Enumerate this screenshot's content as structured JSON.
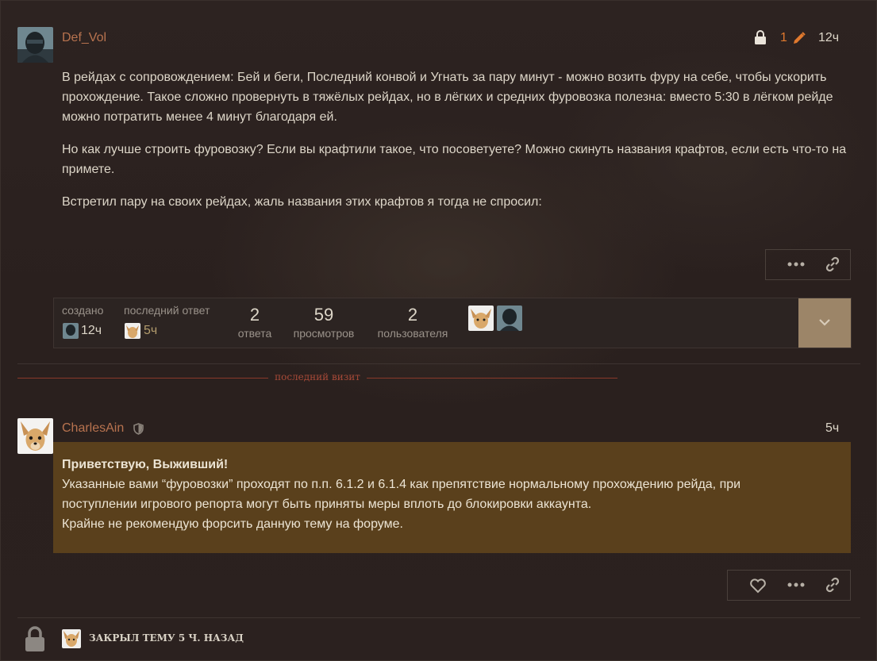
{
  "post1": {
    "username": "Def_Vol",
    "edit_count": "1",
    "time": "12ч",
    "paragraphs": [
      "В рейдах с сопровождением: Бей и беги, Последний конвой и Угнать за пару минут - можно возить фуру на себе, чтобы ускорить прохождение. Такое сложно провернуть в тяжёлых рейдах, но в лёгких и средних фуровозка полезна: вместо 5:30 в лёгком рейде можно потратить менее 4 минут благодаря ей.",
      "Но как лучше строить фуровозку? Если вы крафтили такое, что посоветуете? Можно скинуть названия крафтов, если есть что-то на примете.",
      "Встретил пару на своих рейдах, жаль названия этих крафтов я тогда не спросил:"
    ]
  },
  "topic_map": {
    "created_label": "создано",
    "created_time": "12ч",
    "last_reply_label": "последний ответ",
    "last_reply_time": "5ч",
    "replies_count": "2",
    "replies_label": "ответа",
    "views_count": "59",
    "views_label": "просмотров",
    "users_count": "2",
    "users_label": "пользователя"
  },
  "last_visit_label": "последний визит",
  "post2": {
    "username": "CharlesAin",
    "time": "5ч",
    "greeting": "Приветствую, Выживший!",
    "lines": [
      "Указанные вами “фуровозки” проходят по п.п. 6.1.2 и 6.1.4 как препятствие нормальному прохождению рейда, при",
      "поступлении игрового репорта могут быть приняты меры вплоть до блокировки аккаунта.",
      "Крайне не рекомендую форсить данную тему на форуме."
    ]
  },
  "closed_notice": "ЗАКРЫЛ ТЕМУ 5 Ч. НАЗАД",
  "colors": {
    "accent": "#e0792e",
    "username": "#b8734f",
    "mod_box": "#5a401c",
    "divider": "#8a3a2a"
  },
  "icons": {
    "lock": "lock-icon",
    "pencil": "pencil-icon",
    "more": "more-icon",
    "link": "link-icon",
    "heart": "heart-icon",
    "shield": "shield-icon",
    "chevron": "chevron-down-icon"
  }
}
